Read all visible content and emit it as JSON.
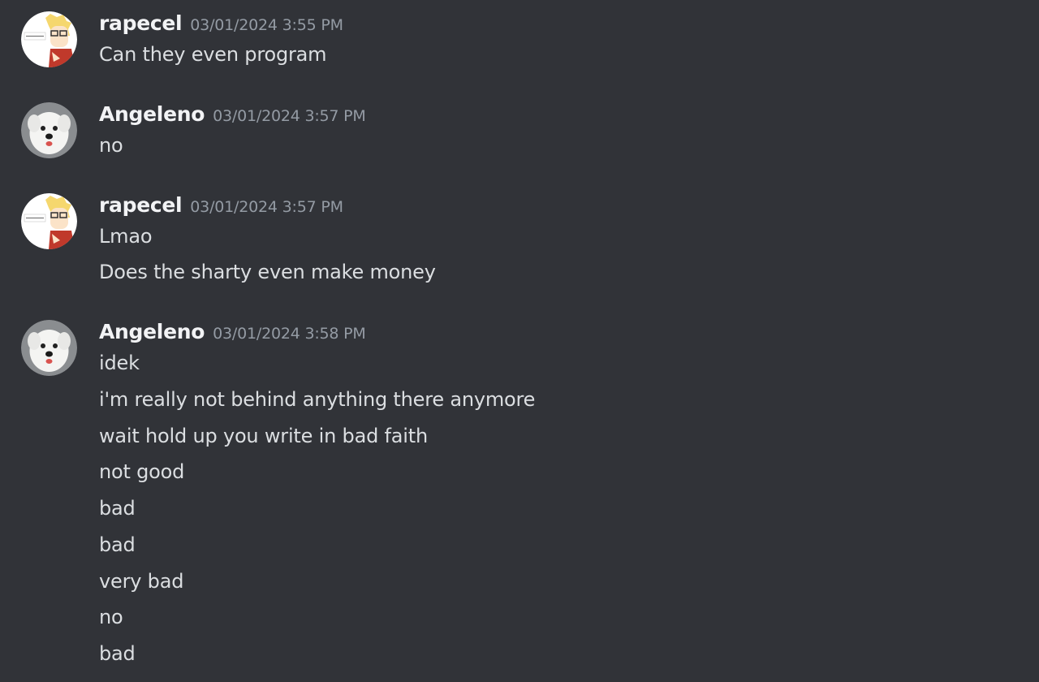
{
  "messages": [
    {
      "username": "rapecel",
      "timestamp": "03/01/2024 3:55 PM",
      "avatar_icon": "anime-character-avatar",
      "lines": [
        "Can they even program"
      ]
    },
    {
      "username": "Angeleno",
      "timestamp": "03/01/2024 3:57 PM",
      "avatar_icon": "white-dog-avatar",
      "lines": [
        "no"
      ]
    },
    {
      "username": "rapecel",
      "timestamp": "03/01/2024 3:57 PM",
      "avatar_icon": "anime-character-avatar",
      "lines": [
        "Lmao",
        "Does the sharty even make money"
      ]
    },
    {
      "username": "Angeleno",
      "timestamp": "03/01/2024 3:58 PM",
      "avatar_icon": "white-dog-avatar",
      "lines": [
        "idek",
        "i'm really not behind anything there anymore",
        "wait hold up you write in bad faith",
        "not good",
        "bad",
        "bad",
        "very bad",
        "no",
        "bad"
      ]
    }
  ],
  "colors": {
    "background": "#313338",
    "username": "#f2f3f5",
    "timestamp": "#949ba4",
    "message_text": "#dbdee1"
  }
}
